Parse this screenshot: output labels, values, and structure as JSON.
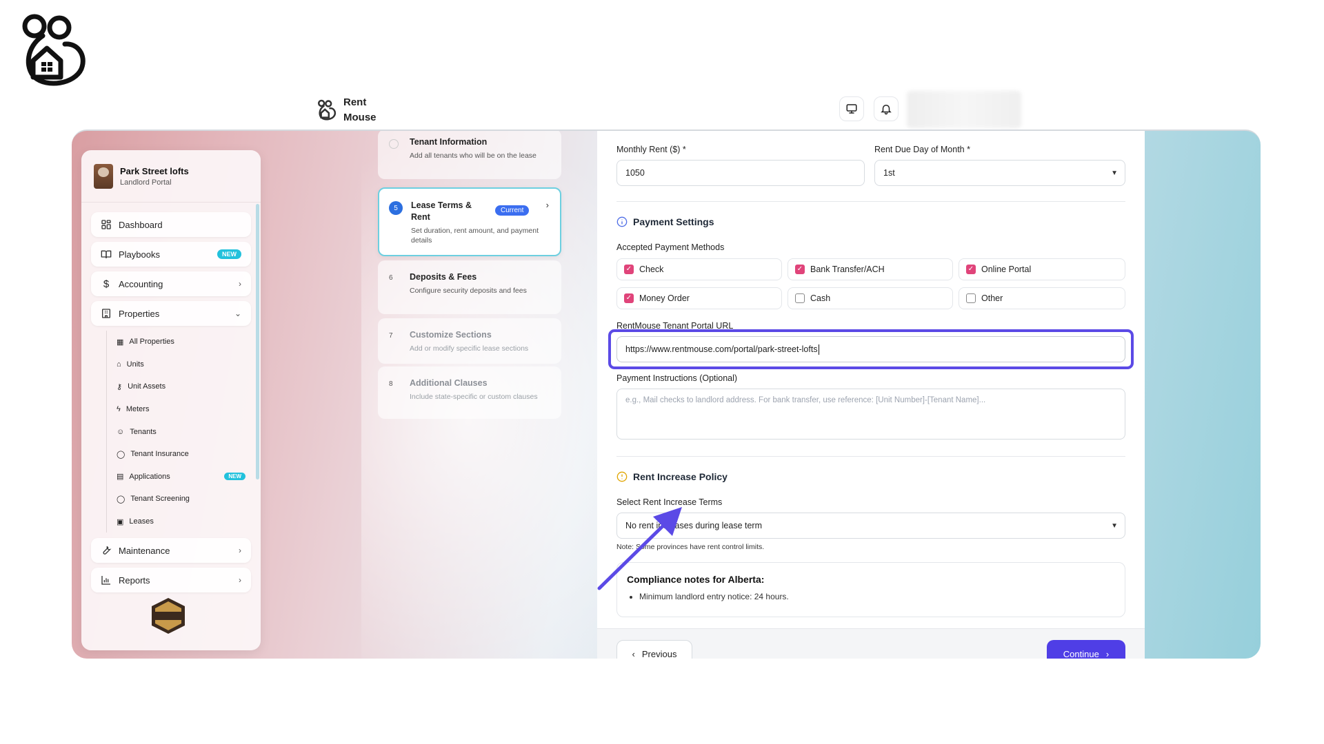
{
  "app": {
    "brand_line1": "Rent",
    "brand_line2": "Mouse"
  },
  "sidebar": {
    "property_name": "Park Street lofts",
    "portal": "Landlord Portal",
    "nav": [
      {
        "label": "Dashboard",
        "icon": "dashboard-icon"
      },
      {
        "label": "Playbooks",
        "icon": "book-icon",
        "badge": "NEW"
      },
      {
        "label": "Accounting",
        "icon": "dollar-icon"
      },
      {
        "label": "Properties",
        "icon": "building-icon"
      }
    ],
    "sub_items": [
      {
        "label": "All Properties",
        "icon": "building-icon"
      },
      {
        "label": "Units",
        "icon": "home-icon"
      },
      {
        "label": "Unit Assets",
        "icon": "key-icon"
      },
      {
        "label": "Meters",
        "icon": "bolt-icon"
      },
      {
        "label": "Tenants",
        "icon": "users-icon"
      },
      {
        "label": "Tenant Insurance",
        "icon": "shield-icon"
      },
      {
        "label": "Applications",
        "icon": "document-icon",
        "badge": "NEW"
      },
      {
        "label": "Tenant Screening",
        "icon": "shield-icon"
      },
      {
        "label": "Leases",
        "icon": "calendar-icon"
      }
    ],
    "nav_bottom": [
      {
        "label": "Maintenance",
        "icon": "wrench-icon"
      },
      {
        "label": "Reports",
        "icon": "chart-icon"
      }
    ]
  },
  "steps": [
    {
      "num": "",
      "title": "Tenant Information",
      "desc": "Add all tenants who will be on the lease"
    },
    {
      "num": "5",
      "title": "Lease Terms & Rent",
      "desc": "Set duration, rent amount, and payment details",
      "badge": "Current"
    },
    {
      "num": "6",
      "title": "Deposits & Fees",
      "desc": "Configure security deposits and fees"
    },
    {
      "num": "7",
      "title": "Customize Sections",
      "desc": "Add or modify specific lease sections"
    },
    {
      "num": "8",
      "title": "Additional Clauses",
      "desc": "Include state-specific or custom clauses"
    }
  ],
  "form": {
    "monthly_rent_label": "Monthly Rent ($) *",
    "monthly_rent_value": "1050",
    "due_day_label": "Rent Due Day of Month *",
    "due_day_value": "1st",
    "payment_settings_title": "Payment Settings",
    "methods_label": "Accepted Payment Methods",
    "methods": [
      {
        "label": "Check",
        "checked": true
      },
      {
        "label": "Bank Transfer/ACH",
        "checked": true
      },
      {
        "label": "Online Portal",
        "checked": true
      },
      {
        "label": "Money Order",
        "checked": true
      },
      {
        "label": "Cash",
        "checked": false
      },
      {
        "label": "Other",
        "checked": false
      }
    ],
    "portal_url_label": "RentMouse Tenant Portal URL",
    "portal_url_value": "https://www.rentmouse.com/portal/park-street-lofts",
    "instructions_label": "Payment Instructions (Optional)",
    "instructions_placeholder": "e.g., Mail checks to landlord address. For bank transfer, use reference: [Unit Number]-[Tenant Name]...",
    "rent_increase_title": "Rent Increase Policy",
    "increase_terms_label": "Select Rent Increase Terms",
    "increase_terms_value": "No rent increases during lease term",
    "increase_note": "Note: Some provinces have rent control limits.",
    "compliance_title": "Compliance notes for Alberta:",
    "compliance_items": [
      "Minimum landlord entry notice: 24 hours."
    ],
    "previous_label": "Previous",
    "continue_label": "Continue"
  },
  "colors": {
    "accent": "#4f3ee6",
    "checkbox": "#e0447a",
    "current_badge": "#3b6ef0",
    "new_badge": "#22c1dc"
  }
}
